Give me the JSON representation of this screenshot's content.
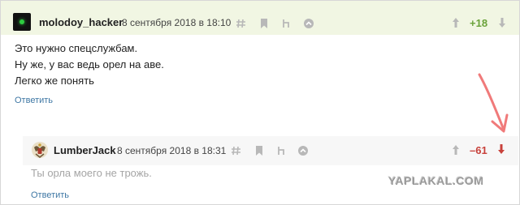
{
  "comment1": {
    "author": "molodoy_hacker",
    "date": "8 сентября 2018 в 18:10",
    "score": "+18",
    "lines": [
      "Это нужно спецслужбам.",
      "Ну же, у вас ведь орел на аве.",
      "Легко же понять"
    ],
    "reply_label": "Ответить"
  },
  "comment2": {
    "author": "LumberJack",
    "date": "8 сентября 2018 в 18:31",
    "score": "–61",
    "text": "Ты орла моего не трожь.",
    "reply_label": "Ответить"
  },
  "watermark": "YAPLAKAL.COM",
  "icons": {
    "link": "hash-icon",
    "bookmark": "bookmark-icon",
    "parent": "parent-link-icon",
    "expand": "expand-icon",
    "upvote": "arrow-up-icon",
    "downvote": "arrow-down-icon"
  },
  "colors": {
    "header_bg": "#f1f6e3",
    "positive": "#6aa23a",
    "negative": "#c8413b",
    "link": "#3e77a4",
    "annotation": "#f07a7a"
  }
}
